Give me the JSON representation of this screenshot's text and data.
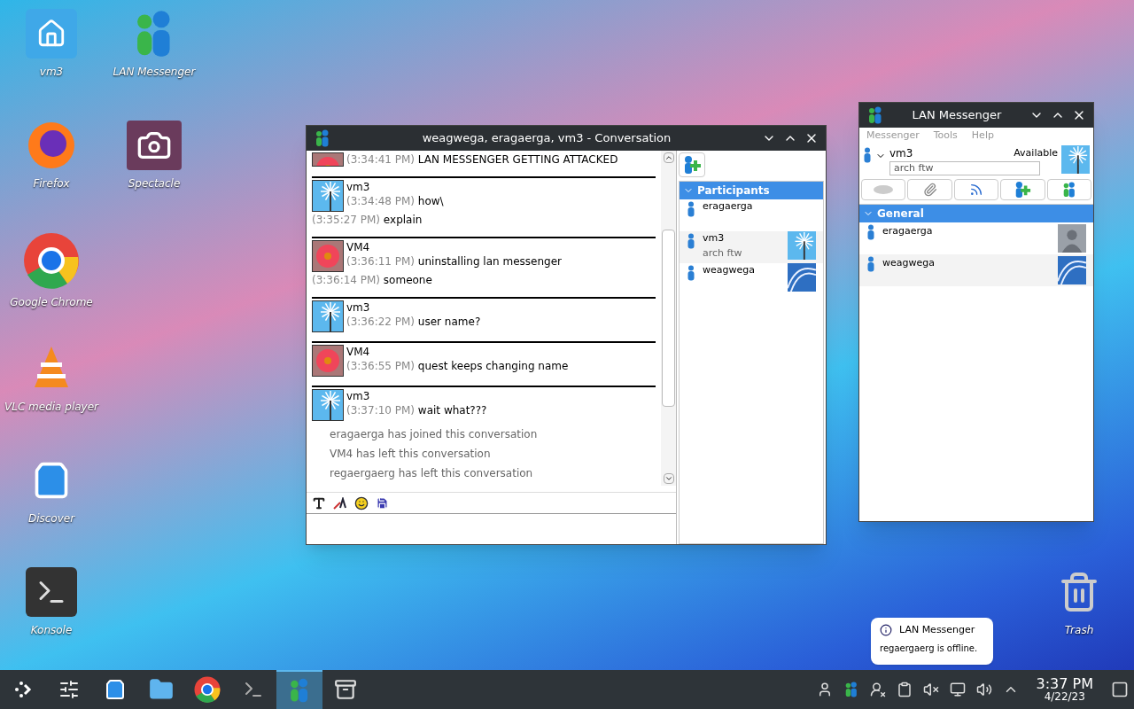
{
  "desktop_icons": [
    {
      "label": "vm3"
    },
    {
      "label": "Firefox"
    },
    {
      "label": "Google Chrome"
    },
    {
      "label": "VLC media player"
    },
    {
      "label": "Discover"
    },
    {
      "label": "Konsole"
    },
    {
      "label": "LAN Messenger"
    },
    {
      "label": "Spectacle"
    },
    {
      "label": "Trash"
    }
  ],
  "conversation": {
    "title": "weagwega, eragaerga, vm3 - Conversation",
    "messages": [
      {
        "kind": "flower",
        "lines": [
          {
            "time": "(3:34:41 PM)",
            "text": "LAN MESSENGER GETTING ATTACKED"
          }
        ]
      },
      {
        "sender": "vm3",
        "kind": "windmill",
        "lines": [
          {
            "time": "(3:34:48 PM)",
            "text": "how\\"
          },
          {
            "time": "(3:35:27 PM)",
            "text": "explain"
          }
        ]
      },
      {
        "sender": "VM4",
        "kind": "flower",
        "lines": [
          {
            "time": "(3:36:11 PM)",
            "text": "uninstalling lan messenger"
          },
          {
            "time": "(3:36:14 PM)",
            "text": "someone"
          }
        ]
      },
      {
        "sender": "vm3",
        "kind": "windmill",
        "lines": [
          {
            "time": "(3:36:22 PM)",
            "text": "user name?"
          }
        ]
      },
      {
        "sender": "VM4",
        "kind": "flower",
        "lines": [
          {
            "time": "(3:36:55 PM)",
            "text": "quest keeps changing name"
          }
        ]
      },
      {
        "sender": "vm3",
        "kind": "windmill",
        "lines": [
          {
            "time": "(3:37:10 PM)",
            "text": "wait what???"
          }
        ]
      }
    ],
    "notices": [
      "eragaerga has joined this conversation",
      "VM4 has left this conversation",
      "regaergaerg has left this conversation"
    ],
    "participants": {
      "header": "Participants",
      "expanded": true,
      "items": [
        {
          "name": "eragaerga",
          "kind": "plain"
        },
        {
          "name": "vm3",
          "note": "arch ftw",
          "kind": "windmill"
        },
        {
          "name": "weagwega",
          "kind": "coaster"
        }
      ]
    }
  },
  "messenger": {
    "title": "LAN Messenger",
    "menu": [
      "Messenger",
      "Tools",
      "Help"
    ],
    "user": {
      "name": "vm3",
      "status": "Available",
      "note": "arch ftw",
      "kind": "windmill"
    },
    "group": {
      "name": "General",
      "expanded": true,
      "contacts": [
        {
          "name": "eragaerga",
          "kind": "silhouette"
        },
        {
          "name": "weagwega",
          "kind": "coaster"
        }
      ]
    }
  },
  "notification": {
    "title": "LAN Messenger",
    "text": "regaergaerg is offline."
  },
  "taskbar": {
    "tasks": [
      {
        "selected": false
      },
      {
        "selected": false
      },
      {
        "selected": false
      },
      {
        "selected": false
      },
      {
        "selected": false
      },
      {
        "selected": false
      },
      {
        "selected": true
      },
      {
        "selected": false
      }
    ],
    "time": "3:37 PM",
    "date": "4/22/23"
  }
}
